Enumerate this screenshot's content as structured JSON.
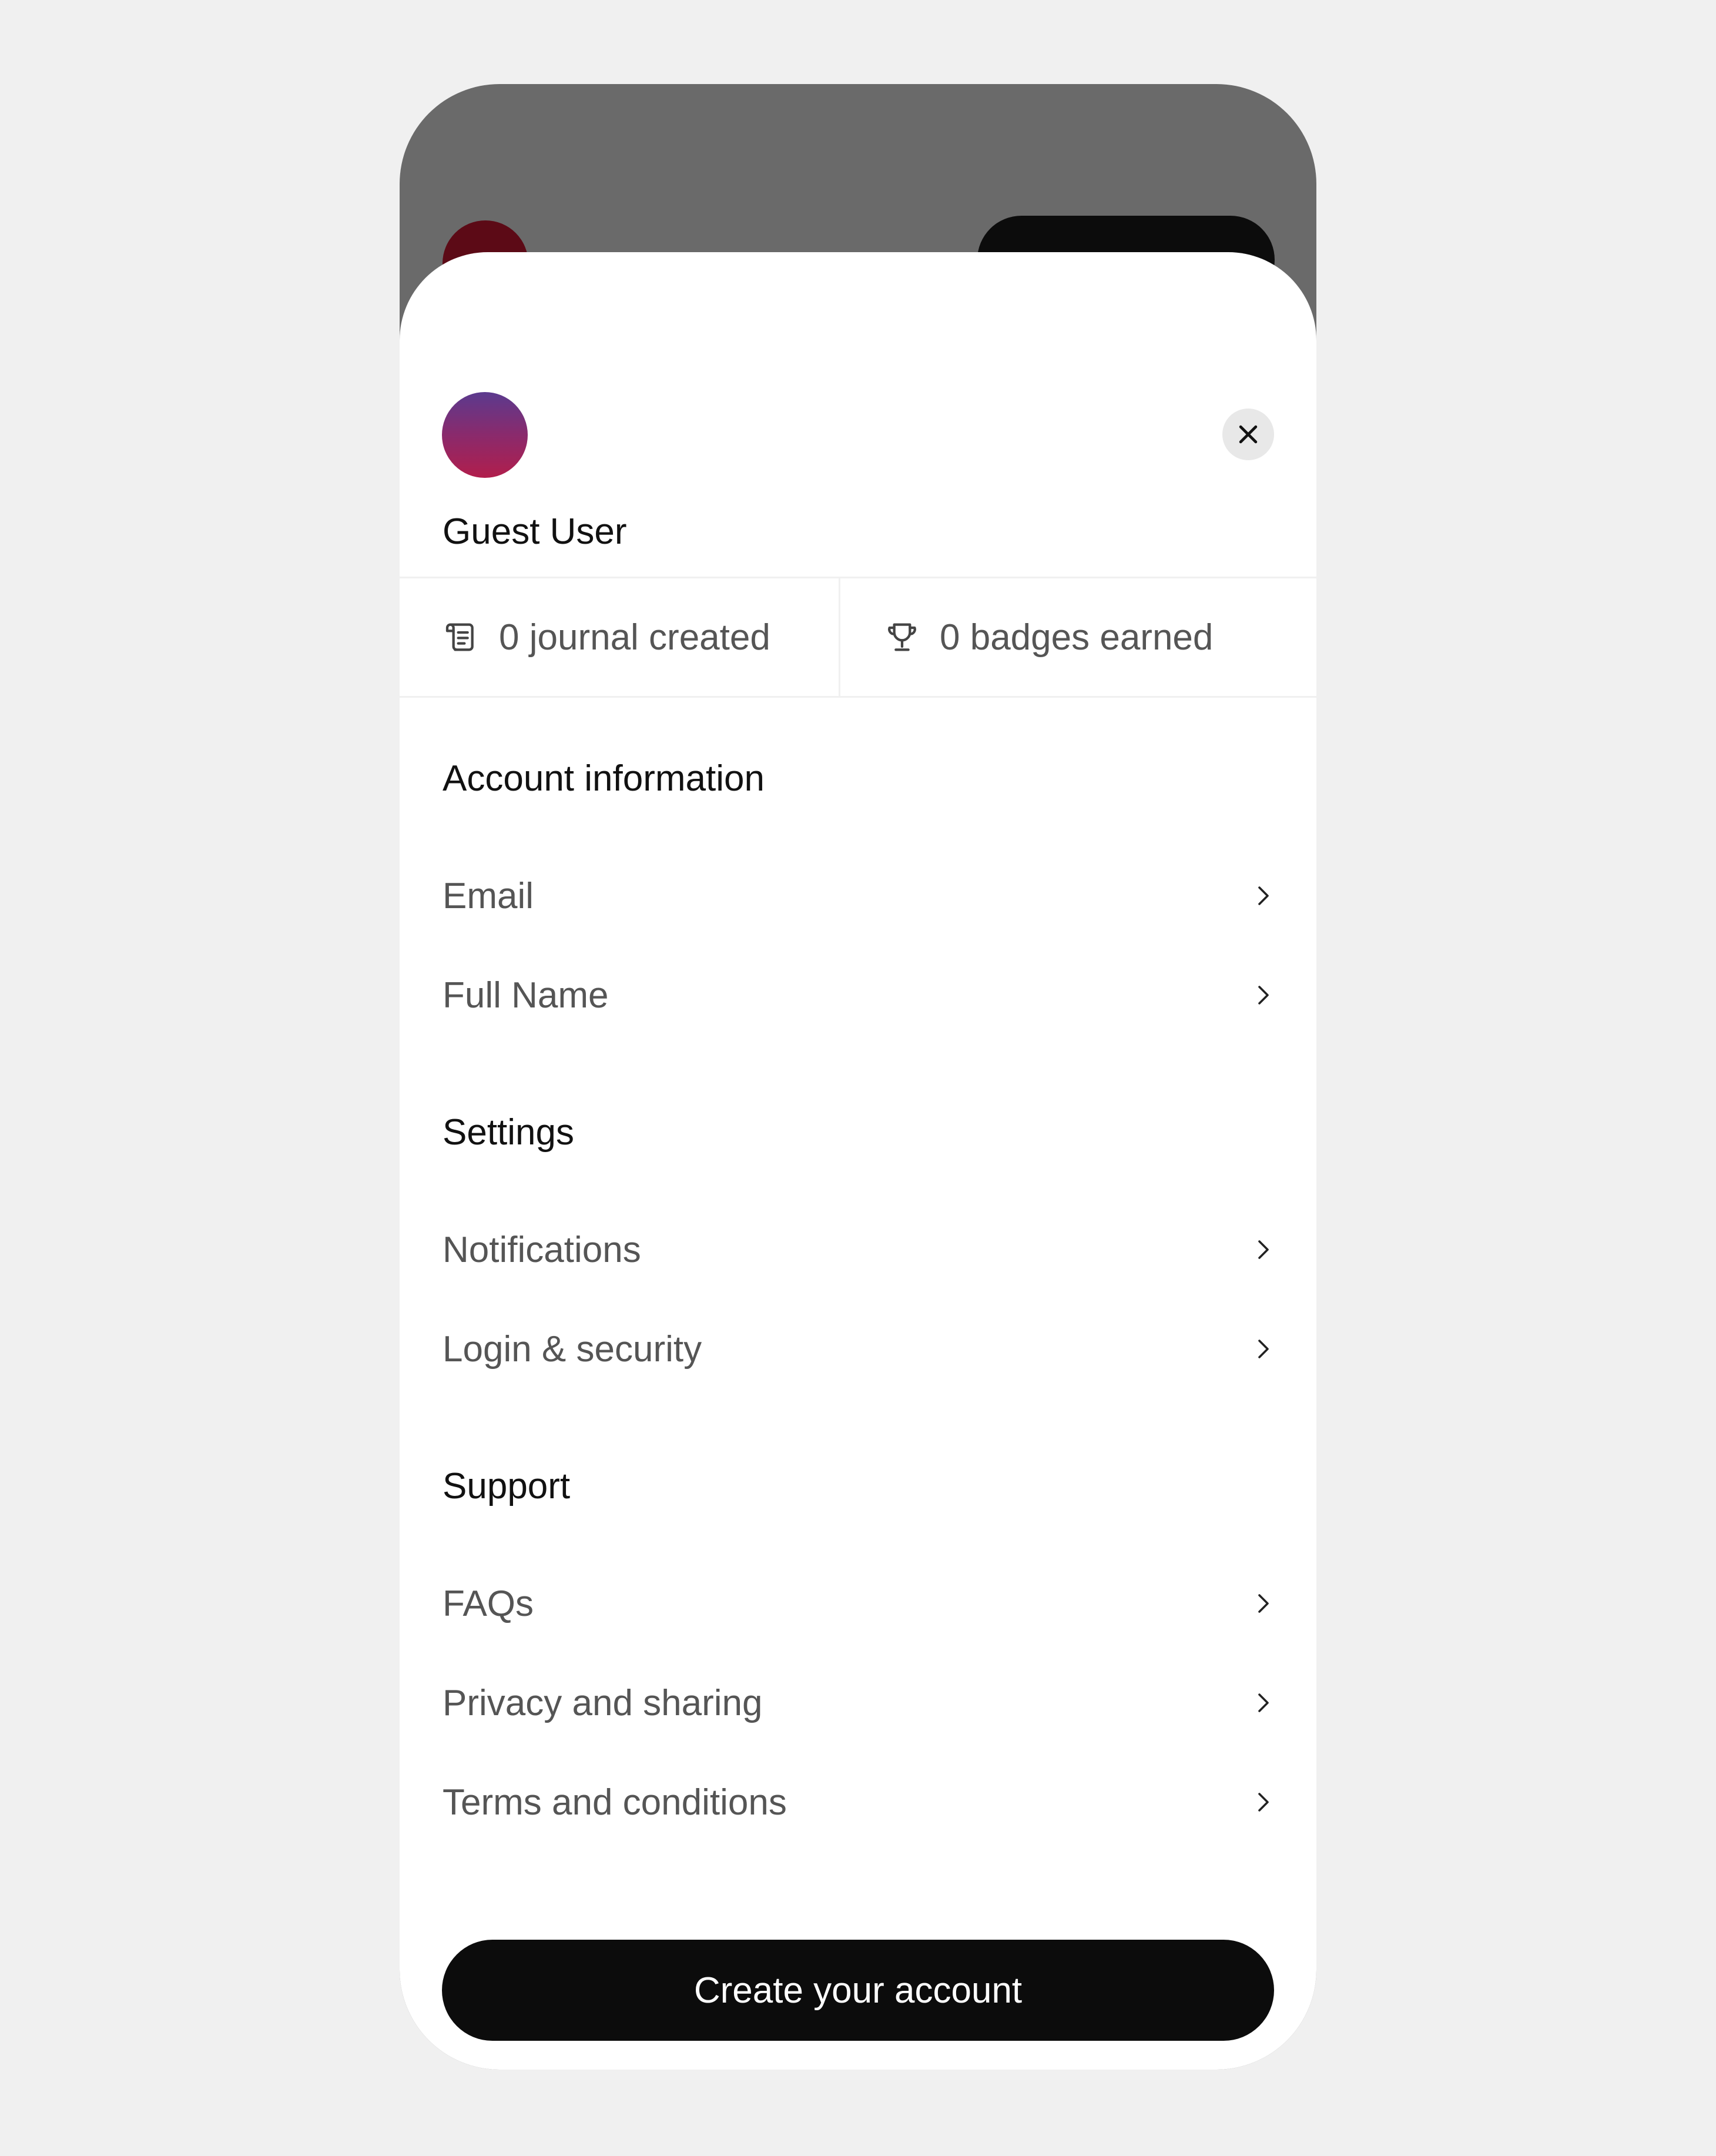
{
  "profile": {
    "name": "Guest User"
  },
  "stats": {
    "journals": "0 journal created",
    "badges": "0 badges earned"
  },
  "sections": [
    {
      "title": "Account information",
      "items": [
        {
          "label": "Email"
        },
        {
          "label": "Full Name"
        }
      ]
    },
    {
      "title": "Settings",
      "items": [
        {
          "label": "Notifications"
        },
        {
          "label": "Login & security"
        }
      ]
    },
    {
      "title": "Support",
      "items": [
        {
          "label": "FAQs"
        },
        {
          "label": "Privacy and sharing"
        },
        {
          "label": "Terms and conditions"
        }
      ]
    }
  ],
  "cta": {
    "label": "Create your account"
  },
  "icons": {
    "close": "close-icon",
    "journal": "scroll-icon",
    "badge": "trophy-icon",
    "row": "chevron-right-icon"
  },
  "colors": {
    "page_bg": "#f0f0f0",
    "overlay": "#6a6a6a",
    "sheet": "#ffffff",
    "primary_button": "#0c0c0c"
  }
}
